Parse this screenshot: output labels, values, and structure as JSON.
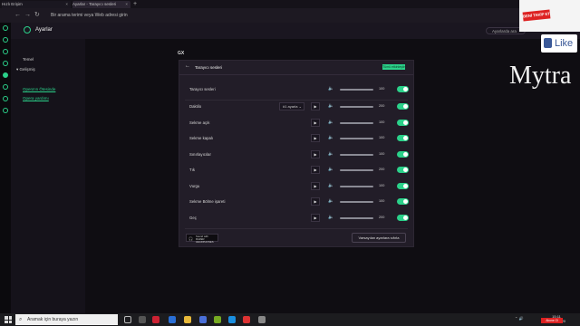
{
  "tabs": [
    {
      "label": "Hızlı Erişim"
    },
    {
      "label": "Ayarlar - Tarayıcı sesleri"
    }
  ],
  "new_tab": "+",
  "nav": {
    "back": "←",
    "forward": "→",
    "reload": "↻"
  },
  "address_bar": {
    "placeholder": "Bir arama terimi veya Web adresi girin"
  },
  "header": {
    "title": "Ayarlar",
    "search_placeholder": "Ayarlarda ara"
  },
  "sidebar": {
    "items": [
      {
        "label": "Temel"
      },
      {
        "label": "Gelişmiş"
      }
    ],
    "links": [
      {
        "label": "Opera'ın Ötesinde"
      },
      {
        "label": "Opera yardımı"
      }
    ]
  },
  "section_label": "GX",
  "panel": {
    "back": "←",
    "title": "Tarayıcı sesleri",
    "top_button": "Tümü etkinleştir",
    "master": {
      "label": "Tarayıcı sesleri",
      "value": "100"
    },
    "rows": [
      {
        "label": "Daktilo",
        "select": "#1 ayarla ⌄",
        "value": "200"
      },
      {
        "label": "Sekme açık",
        "value": "100"
      },
      {
        "label": "Sekme kapalı",
        "value": "100"
      },
      {
        "label": "Sınırlayıcılar",
        "value": "100"
      },
      {
        "label": "Tık",
        "value": "200"
      },
      {
        "label": "Vurgu",
        "value": "100"
      },
      {
        "label": "Sekme Bölme işareti",
        "value": "100"
      },
      {
        "label": "Geç",
        "value": "200"
      }
    ],
    "badge": {
      "line1": "Sound with",
      "line2": "RAZER HEADPHONES"
    },
    "reset_button": "Varsayılan ayarlara sıfırla"
  },
  "overlay": {
    "name": "Mytra",
    "follow_tag": "BENİ TAKİP ET",
    "like": "Like"
  },
  "taskbar": {
    "search_placeholder": "Aramak için buraya yazın",
    "clock_time": "15:11",
    "clock_date": "22.12.2020",
    "subscribe": "Abone Ol"
  },
  "colors": {
    "accent": "#2bd18a",
    "panel_bg": "#221d28",
    "page_bg": "#0f0d12"
  }
}
